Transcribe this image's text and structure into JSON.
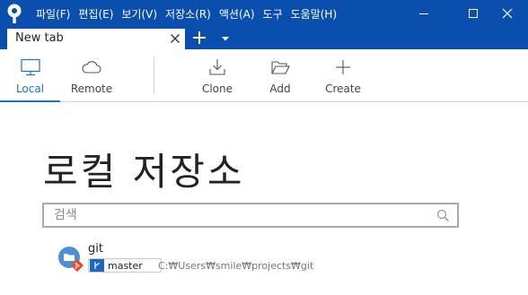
{
  "menu": [
    "파일(F)",
    "편집(E)",
    "보기(V)",
    "저장소(R)",
    "액션(A)",
    "도구",
    "도움말(H)"
  ],
  "tab": {
    "title": "New tab"
  },
  "toolbar": {
    "local": "Local",
    "remote": "Remote",
    "clone": "Clone",
    "add": "Add",
    "create": "Create"
  },
  "page": {
    "title": "로컬 저장소"
  },
  "search": {
    "placeholder": "검색",
    "value": ""
  },
  "repos": [
    {
      "name": "git",
      "branch": "master",
      "path": "C:₩Users₩smile₩projects₩git"
    }
  ],
  "colors": {
    "titlebar": "#0b4fae",
    "accent": "#1a73c9",
    "repo_folder": "#4a90d9",
    "git_badge": "#e94b2e"
  }
}
